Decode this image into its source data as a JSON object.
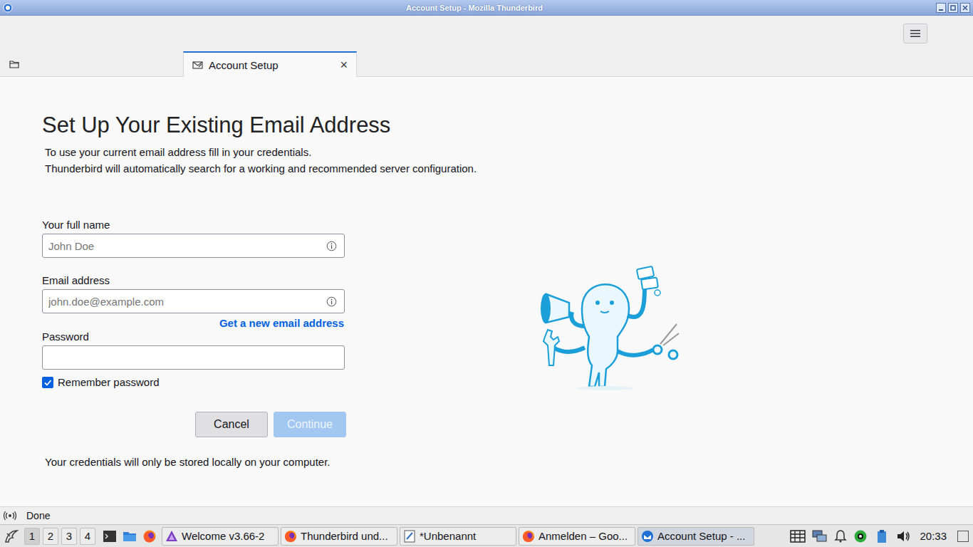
{
  "window": {
    "title": "Account Setup - Mozilla Thunderbird"
  },
  "tabs": [
    {
      "kind": "home",
      "selected": false
    },
    {
      "kind": "page",
      "label": "Account Setup",
      "close": "×",
      "selected": true
    }
  ],
  "page": {
    "heading": "Set Up Your Existing Email Address",
    "intro": [
      "To use your current email address fill in your credentials.",
      "Thunderbird will automatically search for a working and recommended server configuration."
    ]
  },
  "form": {
    "fields": [
      {
        "label": "Your full name",
        "placeholder": "John Doe",
        "kind": "info"
      },
      {
        "label": "Email address",
        "placeholder": "john.doe@example.com",
        "kind": "info"
      },
      {
        "label": "Password",
        "placeholder": "",
        "kind": "password"
      }
    ],
    "link": "Get a new email address",
    "remember": {
      "label": "Remember password",
      "checked": true
    },
    "buttons": [
      {
        "label": "Cancel",
        "disabled": false
      },
      {
        "label": "Continue",
        "disabled": true
      }
    ],
    "note": "Your credentials will only be stored locally on your computer."
  },
  "status_bar": {
    "text": "Done"
  },
  "taskbar": {
    "workspaces": [
      {
        "label": "1",
        "selected": true
      },
      {
        "label": "2",
        "selected": false
      },
      {
        "label": "3",
        "selected": false
      },
      {
        "label": "4",
        "selected": false
      }
    ],
    "tasks": [
      {
        "label": "Welcome v3.66-2",
        "kind": "kvantum",
        "selected": false
      },
      {
        "label": "Thunderbird und...",
        "kind": "firefox",
        "selected": false
      },
      {
        "label": "*Unbenannt",
        "kind": "editor",
        "selected": false
      },
      {
        "label": "Anmelden – Goo...",
        "kind": "firefox",
        "selected": false
      },
      {
        "label": "Account Setup - ...",
        "kind": "thunderbird",
        "selected": true
      }
    ],
    "clock": "20:33"
  }
}
